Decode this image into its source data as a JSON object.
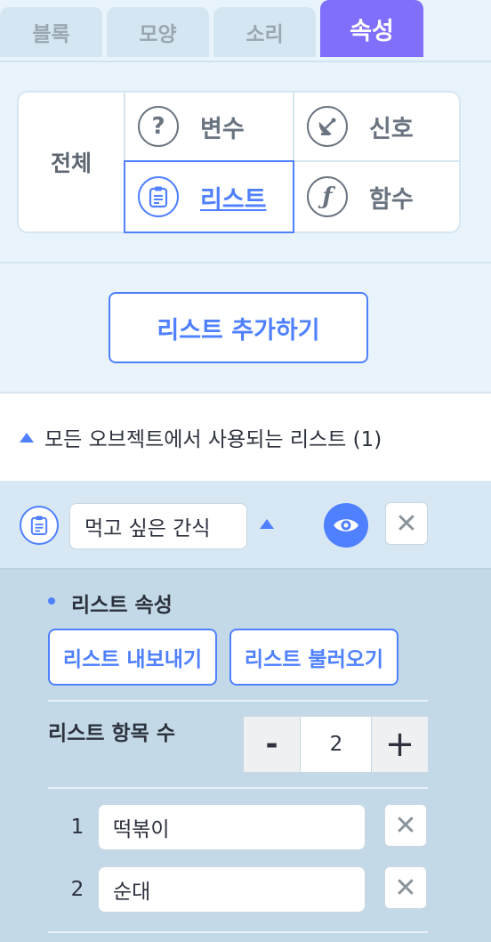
{
  "tabs": [
    {
      "label": "블록"
    },
    {
      "label": "모양"
    },
    {
      "label": "소리"
    },
    {
      "label": "속성"
    }
  ],
  "categories": {
    "all_label": "전체",
    "variable": {
      "label": "변수",
      "icon": "question-icon"
    },
    "signal": {
      "label": "신호",
      "icon": "satellite-dish-icon"
    },
    "list": {
      "label": "리스트",
      "icon": "clipboard-icon"
    },
    "function": {
      "label": "함수",
      "icon": "function-icon"
    }
  },
  "add_list_label": "리스트 추가하기",
  "section": {
    "title": "모든 오브젝트에서 사용되는 리스트 (1)"
  },
  "list": {
    "name": "먹고 싶은 간식",
    "props_title": "리스트 속성",
    "export_label": "리스트 내보내기",
    "import_label": "리스트 불러오기",
    "count_label": "리스트 항목 수",
    "count_minus": "-",
    "count_value": "2",
    "count_plus": "+",
    "items": [
      {
        "num": "1",
        "value": "떡볶이"
      },
      {
        "num": "2",
        "value": "순대"
      }
    ]
  },
  "colors": {
    "accent": "#4f80ff",
    "active_tab": "#7f6ffa"
  }
}
